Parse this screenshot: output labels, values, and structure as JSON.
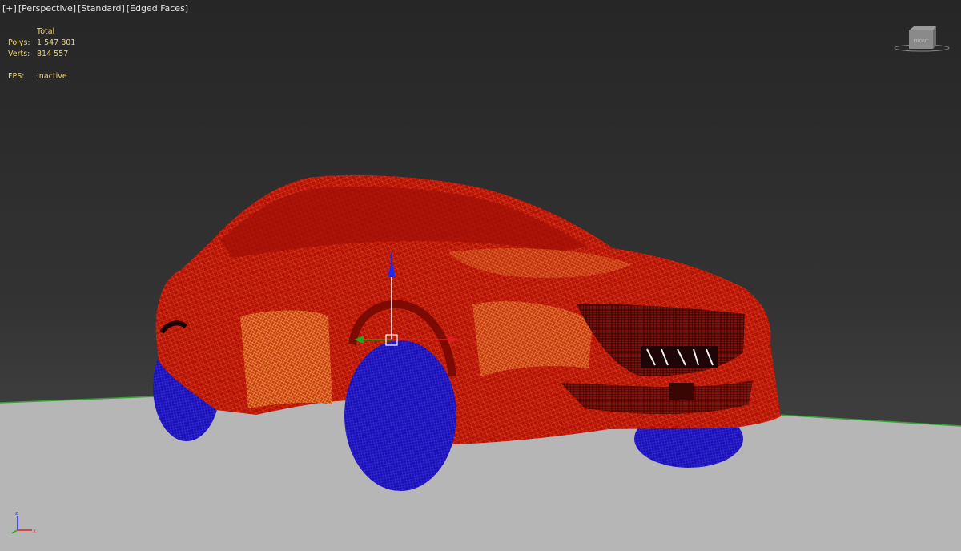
{
  "viewport": {
    "labels": [
      "[+]",
      "[Perspective]",
      "[Standard]",
      "[Edged Faces]"
    ]
  },
  "stats": {
    "header": "Total",
    "polys_label": "Polys:",
    "polys_value": "1 547 801",
    "verts_label": "Verts:",
    "verts_value": "814 557",
    "fps_label": "FPS:",
    "fps_value": "Inactive"
  },
  "viewcube": {
    "face_label": "FRONT"
  },
  "axis_tripod": {
    "z": "z",
    "x": "x"
  },
  "colors": {
    "car_body": "#b01005",
    "car_wire": "#ff5a2a",
    "car_highlight": "#f2a23c",
    "wheels": "#1a12b8",
    "ground": "#b6b6b6",
    "horizon_line": "#2fa52f",
    "stats_text": "#f0d66a",
    "gizmo_z": "#1a2bff",
    "gizmo_x": "#e01e1e",
    "gizmo_y": "#1aa81a"
  }
}
